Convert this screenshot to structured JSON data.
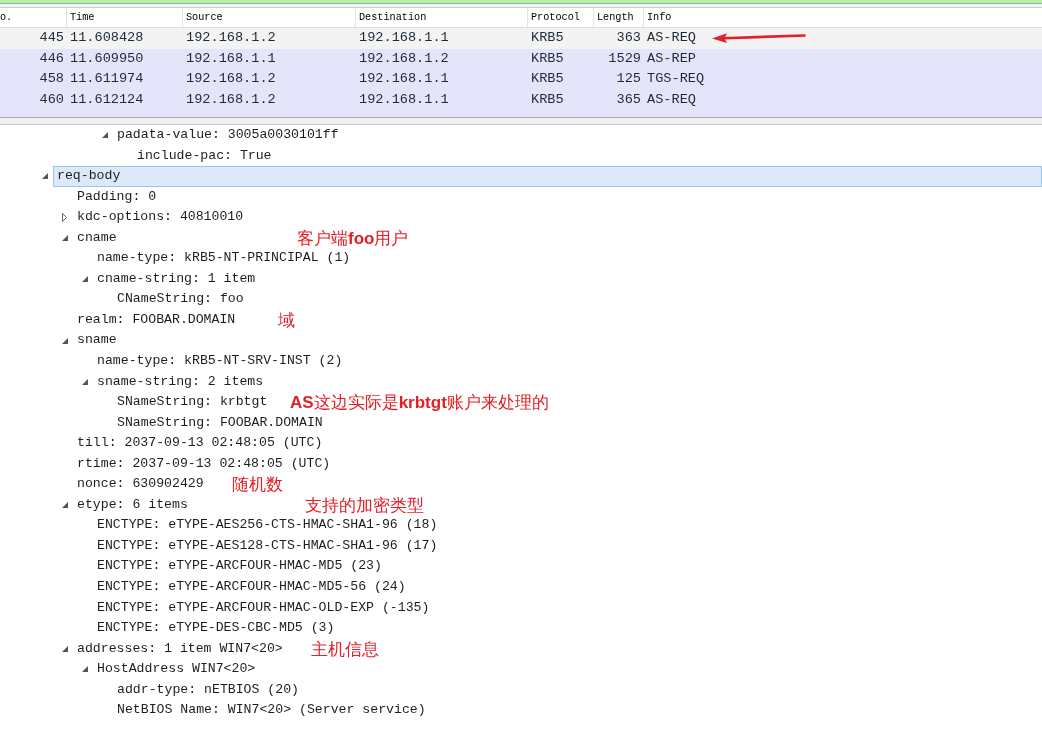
{
  "filter_bar": {
    "valid": true
  },
  "packet_list": {
    "columns": [
      "o.",
      "Time",
      "Source",
      "Destination",
      "Protocol",
      "Length",
      "Info"
    ],
    "rows": [
      {
        "cells": [
          "445",
          "11.608428",
          "192.168.1.2",
          "192.168.1.1",
          "KRB5",
          "363",
          "AS-REQ"
        ],
        "selected": true,
        "arrow": true
      },
      {
        "cells": [
          "446",
          "11.609950",
          "192.168.1.1",
          "192.168.1.2",
          "KRB5",
          "1529",
          "AS-REP"
        ],
        "selected": false,
        "arrow": false
      },
      {
        "cells": [
          "458",
          "11.611974",
          "192.168.1.2",
          "192.168.1.1",
          "KRB5",
          "125",
          "TGS-REQ"
        ],
        "selected": false,
        "arrow": false
      },
      {
        "cells": [
          "460",
          "11.612124",
          "192.168.1.2",
          "192.168.1.1",
          "KRB5",
          "365",
          "AS-REQ"
        ],
        "selected": false,
        "arrow": false
      }
    ]
  },
  "tree_continued": [
    {
      "label": "padata-value: 3005a0030101ff",
      "expanded": true,
      "selected": false,
      "children": [
        {
          "label": "include-pac: True",
          "selected": false
        }
      ]
    }
  ],
  "tree": [
    {
      "label": "req-body",
      "expanded": true,
      "selected": true,
      "children": [
        {
          "label": "Padding: 0",
          "selected": false
        },
        {
          "label": "kdc-options: 40810010",
          "expanded": false,
          "selected": false
        },
        {
          "label": "cname",
          "expanded": true,
          "selected": false,
          "note": "客户端**foo**用户",
          "children": [
            {
              "label": "name-type: kRB5-NT-PRINCIPAL (1)",
              "selected": false
            },
            {
              "label": "cname-string: 1 item",
              "expanded": true,
              "selected": false,
              "children": [
                {
                  "label": "CNameString: foo",
                  "selected": false
                }
              ]
            }
          ]
        },
        {
          "label": "realm: FOOBAR.DOMAIN",
          "selected": false,
          "note": "域"
        },
        {
          "label": "sname",
          "expanded": true,
          "selected": false,
          "children": [
            {
              "label": "name-type: kRB5-NT-SRV-INST (2)",
              "selected": false
            },
            {
              "label": "sname-string: 2 items",
              "expanded": true,
              "selected": false,
              "children": [
                {
                  "label": "SNameString: krbtgt",
                  "selected": false,
                  "note": "**AS**这边实际是**krbtgt**账户来处理的"
                },
                {
                  "label": "SNameString: FOOBAR.DOMAIN",
                  "selected": false
                }
              ]
            }
          ]
        },
        {
          "label": "till: 2037-09-13 02:48:05 (UTC)",
          "selected": false
        },
        {
          "label": "rtime: 2037-09-13 02:48:05 (UTC)",
          "selected": false
        },
        {
          "label": "nonce: 630902429",
          "selected": false,
          "note": "随机数"
        },
        {
          "label": "etype: 6 items",
          "expanded": true,
          "selected": false,
          "note": "支持的加密类型",
          "children": [
            {
              "label": "ENCTYPE: eTYPE-AES256-CTS-HMAC-SHA1-96 (18)",
              "selected": false
            },
            {
              "label": "ENCTYPE: eTYPE-AES128-CTS-HMAC-SHA1-96 (17)",
              "selected": false
            },
            {
              "label": "ENCTYPE: eTYPE-ARCFOUR-HMAC-MD5 (23)",
              "selected": false
            },
            {
              "label": "ENCTYPE: eTYPE-ARCFOUR-HMAC-MD5-56 (24)",
              "selected": false
            },
            {
              "label": "ENCTYPE: eTYPE-ARCFOUR-HMAC-OLD-EXP (-135)",
              "selected": false
            },
            {
              "label": "ENCTYPE: eTYPE-DES-CBC-MD5 (3)",
              "selected": false
            }
          ]
        },
        {
          "label": "addresses: 1 item WIN7<20>",
          "expanded": true,
          "selected": false,
          "note": "主机信息",
          "children": [
            {
              "label": "HostAddress WIN7<20>",
              "expanded": true,
              "selected": false,
              "children": [
                {
                  "label": "addr-type: nETBIOS (20)",
                  "selected": false
                },
                {
                  "label": "NetBIOS Name: WIN7<20> (Server service)",
                  "selected": false
                }
              ]
            }
          ]
        }
      ]
    }
  ]
}
